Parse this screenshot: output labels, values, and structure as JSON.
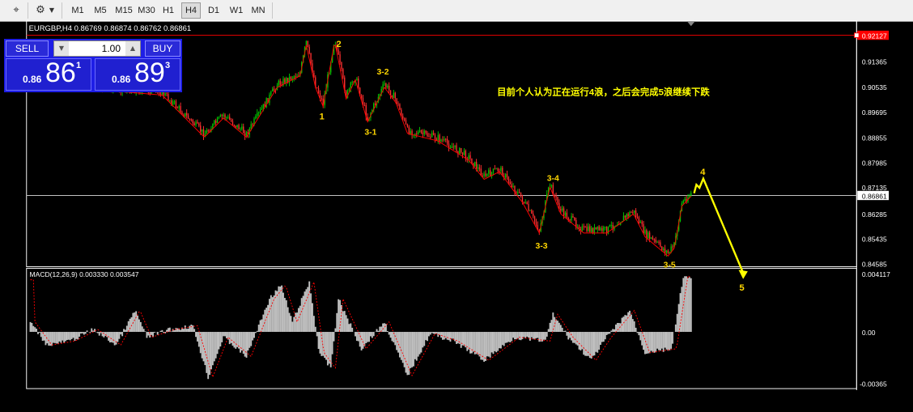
{
  "toolbar": {
    "timeframes": [
      "M1",
      "M5",
      "M15",
      "M30",
      "H1",
      "H4",
      "D1",
      "W1",
      "MN"
    ],
    "active_timeframe": "H4"
  },
  "symbol_info": "EURGBP,H4  0.86769 0.86874 0.86762 0.86861",
  "ticket": {
    "sell_label": "SELL",
    "buy_label": "BUY",
    "volume": "1.00",
    "sell_prefix": "0.86",
    "sell_big": "86",
    "sell_sup": "1",
    "buy_prefix": "0.86",
    "buy_big": "89",
    "buy_sup": "3"
  },
  "price_axis": {
    "ticks": [
      "0.91365",
      "0.90535",
      "0.89695",
      "0.88855",
      "0.87985",
      "0.87135",
      "0.86285",
      "0.85435",
      "0.84585"
    ],
    "current_price": "0.86861",
    "red_level": "0.92127"
  },
  "annotation_text": "目前个人认为正在运行4浪，之后会完成5浪继续下跌",
  "wave_labels": [
    "1",
    "2",
    "3-1",
    "3-2",
    "3-3",
    "3-4",
    "3-5",
    "4",
    "5"
  ],
  "macd": {
    "label": "MACD(12,26,9) 0.003330 0.003547",
    "ticks": [
      "0.004117",
      "0.00",
      "-0.00365"
    ]
  },
  "colors": {
    "bull": "#00c800",
    "bear": "#ff3030",
    "wave_label": "#ffd700",
    "forecast": "#ffff00",
    "ma": "#ff0000",
    "red_level": "#ff0000",
    "histogram": "#c0c0c0"
  }
}
